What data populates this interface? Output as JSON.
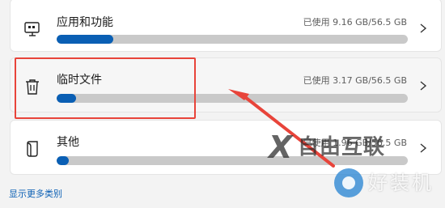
{
  "categories": [
    {
      "title": "应用和功能",
      "usage": "已使用 9.16 GB/56.5 GB",
      "fill_fraction": 0.162,
      "icon": "apps-icon"
    },
    {
      "title": "临时文件",
      "usage": "已使用 3.17 GB/56.5 GB",
      "fill_fraction": 0.056,
      "icon": "trash-icon"
    },
    {
      "title": "其他",
      "usage": "已使用 1.96 GB/56.5 GB",
      "fill_fraction": 0.035,
      "icon": "document-icon"
    }
  ],
  "show_more": "显示更多类别",
  "watermark": {
    "line1": "自由互联",
    "line2": "好装机",
    "mark": "X"
  },
  "colors": {
    "accent": "#0a5fb4",
    "highlight": "#e8443a",
    "track": "#c9c9c9"
  }
}
